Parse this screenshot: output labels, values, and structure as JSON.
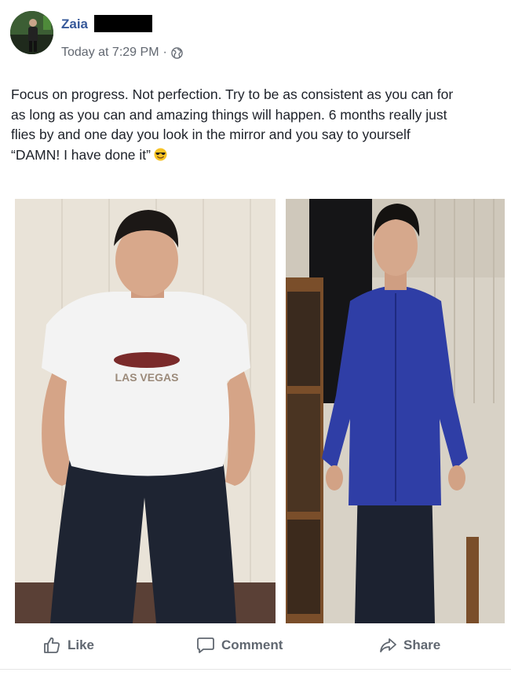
{
  "post": {
    "author_name": "Zaia",
    "timestamp": "Today at 7:29 PM",
    "separator": "·",
    "privacy_icon": "globe-icon",
    "text_lines": [
      "Focus on progress. Not perfection. Try to be as consistent as you can for",
      "as long as you can and amazing things will happen. 6 months really just",
      "flies by and one day you look in the mirror and you say to yourself",
      "“DAMN! I have done it”"
    ],
    "text_emoji": "smiling-face-with-sunglasses-icon",
    "photos": [
      {
        "shirt_print_text": "LAS VEGAS"
      },
      {}
    ]
  },
  "actions": {
    "like_label": "Like",
    "comment_label": "Comment",
    "share_label": "Share"
  },
  "colors": {
    "name_link": "#365899",
    "meta_text": "#616770",
    "action_text": "#606770",
    "body_text": "#1d2129"
  }
}
